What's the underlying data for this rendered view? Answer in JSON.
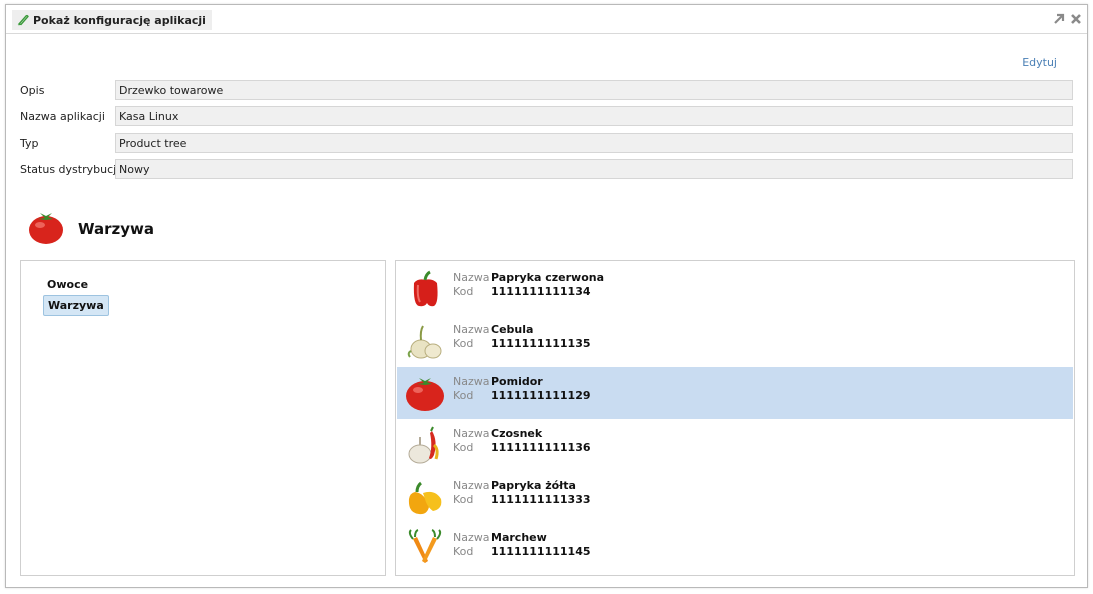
{
  "window": {
    "title": "Pokaż konfigurację aplikacji",
    "edit_label": "Edytuj"
  },
  "fields": [
    {
      "label": "Opis",
      "value": "Drzewko towarowe"
    },
    {
      "label": "Nazwa aplikacji",
      "value": "Kasa Linux"
    },
    {
      "label": "Typ",
      "value": "Product tree"
    },
    {
      "label": "Status dystrybucji",
      "value": "Nowy"
    }
  ],
  "section": {
    "title": "Warzywa",
    "icon": "tomato-icon"
  },
  "tree": {
    "items": [
      {
        "label": "Owoce",
        "selected": false
      },
      {
        "label": "Warzywa",
        "selected": true
      }
    ]
  },
  "products": {
    "name_label": "Nazwa",
    "code_label": "Kod",
    "items": [
      {
        "name": "Papryka czerwona",
        "code": "1111111111134",
        "icon": "red-pepper-icon",
        "selected": false
      },
      {
        "name": "Cebula",
        "code": "1111111111135",
        "icon": "onion-icon",
        "selected": false
      },
      {
        "name": "Pomidor",
        "code": "1111111111129",
        "icon": "tomato-icon",
        "selected": true
      },
      {
        "name": "Czosnek",
        "code": "1111111111136",
        "icon": "garlic-icon",
        "selected": false
      },
      {
        "name": "Papryka żółta",
        "code": "1111111111333",
        "icon": "yellow-pepper-icon",
        "selected": false
      },
      {
        "name": "Marchew",
        "code": "1111111111145",
        "icon": "carrot-icon",
        "selected": false
      }
    ]
  },
  "colors": {
    "selection": "#c9dcf1",
    "link": "#4a7fb5",
    "field_bg": "#f0f0f0"
  }
}
